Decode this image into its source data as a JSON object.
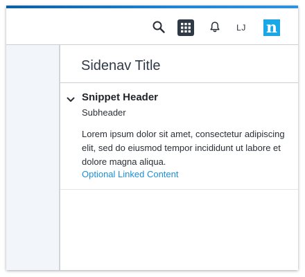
{
  "header": {
    "icons": [
      "search-icon",
      "grid-icon",
      "bell-icon"
    ],
    "avatar_initials": "LJ",
    "logo_letter": "n"
  },
  "sidenav": {
    "title": "Sidenav Title"
  },
  "snippet": {
    "header": "Snippet Header",
    "subheader": "Subheader",
    "body": "Lorem ipsum dolor sit amet, consectetur adipiscing elit, sed do eiusmod tempor incididunt ut labore et dolore magna aliqua.",
    "link": "Optional Linked Content"
  },
  "colors": {
    "accent": "#1f86d6",
    "link": "#1a8fd6",
    "logo_bg": "#1aa7e8",
    "rail_bg": "#f2f6fa"
  }
}
